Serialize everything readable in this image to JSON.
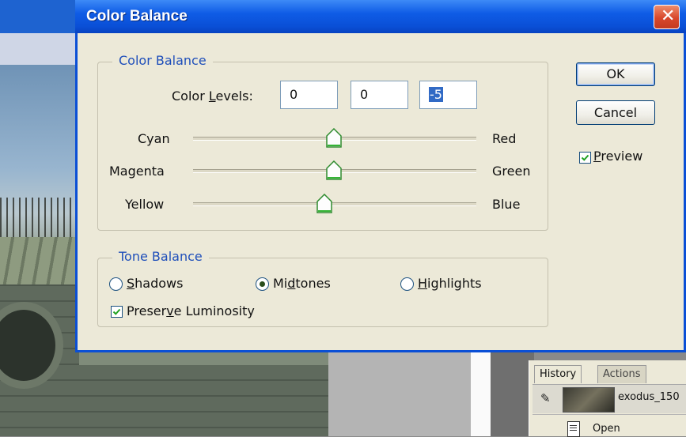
{
  "dialog": {
    "title": "Color Balance",
    "color_balance_group": {
      "legend": "Color Balance",
      "levels_label_pre": "Color ",
      "levels_label_key": "L",
      "levels_label_post": "evels:",
      "level_values": [
        "0",
        "0",
        "-5"
      ],
      "sliders": [
        {
          "left": "Cyan",
          "right": "Red",
          "value": 0
        },
        {
          "left": "Magenta",
          "right": "Green",
          "value": 0
        },
        {
          "left": "Yellow",
          "right": "Blue",
          "value": -5
        }
      ]
    },
    "tone_balance_group": {
      "legend": "Tone Balance",
      "shadows_key": "S",
      "shadows_rest": "hadows",
      "midtones_pre": "Mi",
      "midtones_key": "d",
      "midtones_post": "tones",
      "highlights_key": "H",
      "highlights_rest": "ighlights",
      "selected": "Midtones",
      "preserve_pre": "Preser",
      "preserve_key": "v",
      "preserve_post": "e Luminosity",
      "preserve_checked": true
    },
    "ok_label": "OK",
    "cancel_label": "Cancel",
    "preview_key": "P",
    "preview_rest": "review",
    "preview_checked": true
  },
  "history_panel": {
    "tabs": [
      "History",
      "Actions"
    ],
    "snapshot_name": "exodus_150",
    "rows": [
      "Open"
    ]
  },
  "colors": {
    "title_bar": "#0a4fd6",
    "group_legend": "#1f4fba",
    "dialog_face": "#ece9d8",
    "close_button": "#d8472b"
  }
}
